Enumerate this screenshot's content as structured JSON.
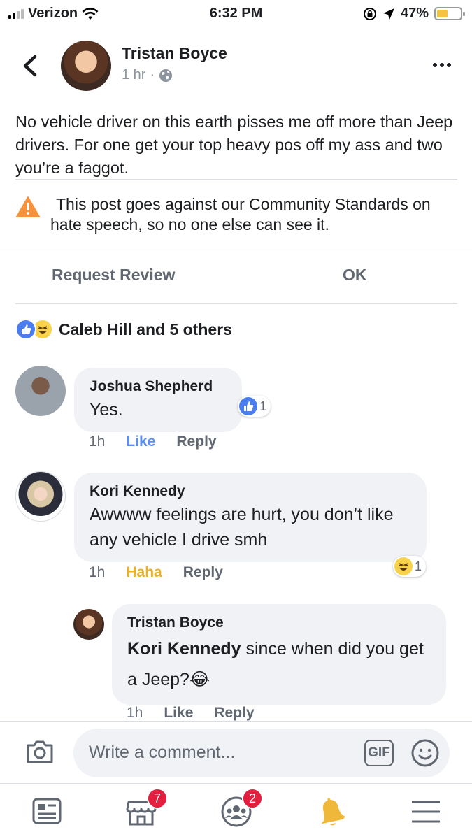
{
  "status_bar": {
    "carrier": "Verizon",
    "time": "6:32 PM",
    "battery": "47%"
  },
  "post": {
    "author": "Tristan Boyce",
    "time": "1 hr",
    "text": "No vehicle driver on this earth pisses me off more than Jeep drivers. For one get your top heavy pos off my ass and two you’re a faggot."
  },
  "warning": {
    "text": "This post goes against our Community Standards on hate speech, so no one else can see it.",
    "request_review": "Request Review",
    "ok": "OK"
  },
  "reactions": {
    "summary": "Caleb Hill and 5 others"
  },
  "comments": [
    {
      "name": "Joshua Shepherd",
      "text": "Yes.",
      "time": "1h",
      "like": "Like",
      "reply": "Reply",
      "reaction_count": "1",
      "reaction": "like",
      "reacted_label_color": "#5b8ef1"
    },
    {
      "name": "Kori Kennedy",
      "text": "Awwww feelings are hurt, you don’t like any vehicle I drive smh",
      "time": "1h",
      "like": "Haha",
      "reply": "Reply",
      "reaction_count": "1",
      "reaction": "haha",
      "reacted_label_color": "#eab026"
    }
  ],
  "reply": {
    "name": "Tristan Boyce",
    "mention": "Kori Kennedy",
    "text": " since when did you get a Jeep?",
    "emoji": "😂",
    "time": "1h",
    "like": "Like",
    "reply": "Reply"
  },
  "composer": {
    "placeholder": "Write a comment...",
    "gif": "GIF"
  },
  "tab_bar": {
    "items": [
      {
        "icon": "news-feed-icon",
        "badge": ""
      },
      {
        "icon": "marketplace-icon",
        "badge": "7"
      },
      {
        "icon": "groups-icon",
        "badge": "2"
      },
      {
        "icon": "notifications-bell-icon",
        "badge": ""
      },
      {
        "icon": "menu-icon",
        "badge": ""
      }
    ]
  },
  "colors": {
    "like_blue": "#4a7df0",
    "haha_yellow": "#f7d24a",
    "badge_red": "#e41e3f",
    "warning_orange": "#f7923a"
  }
}
